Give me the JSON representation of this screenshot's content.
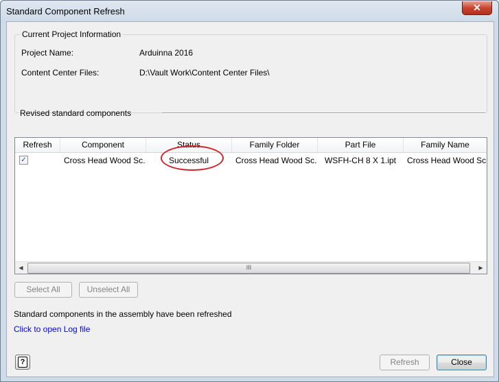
{
  "window": {
    "title": "Standard Component Refresh",
    "close_label": "✕"
  },
  "project_info": {
    "group_title": "Current Project Information",
    "project_name_label": "Project Name:",
    "project_name_value": "Arduinna 2016",
    "content_center_label": "Content Center Files:",
    "content_center_value": "D:\\Vault Work\\Content Center Files\\"
  },
  "revised_section": {
    "label": "Revised standard components"
  },
  "table": {
    "columns": [
      "Refresh",
      "Component",
      "Status",
      "Family Folder",
      "Part File",
      "Family Name"
    ],
    "rows": [
      {
        "refresh_checked": true,
        "component": "Cross Head Wood Sc...",
        "status": "Successful",
        "family_folder": "Cross Head Wood Sc...",
        "part_file": "WSFH-CH 8 X 1.ipt",
        "family_name": "Cross Head Wood Sc..."
      }
    ],
    "scroll_thumb_glyph": "III"
  },
  "selection_buttons": {
    "select_all": "Select All",
    "unselect_all": "Unselect All"
  },
  "messages": {
    "status_message": "Standard components in the assembly have been refreshed",
    "log_link": "Click to open Log file"
  },
  "footer": {
    "help_glyph": "?",
    "refresh_label": "Refresh",
    "close_label": "Close"
  },
  "colors": {
    "link": "#0000ff",
    "annotation_ring": "#d12428",
    "close_button": "#c9452f"
  }
}
